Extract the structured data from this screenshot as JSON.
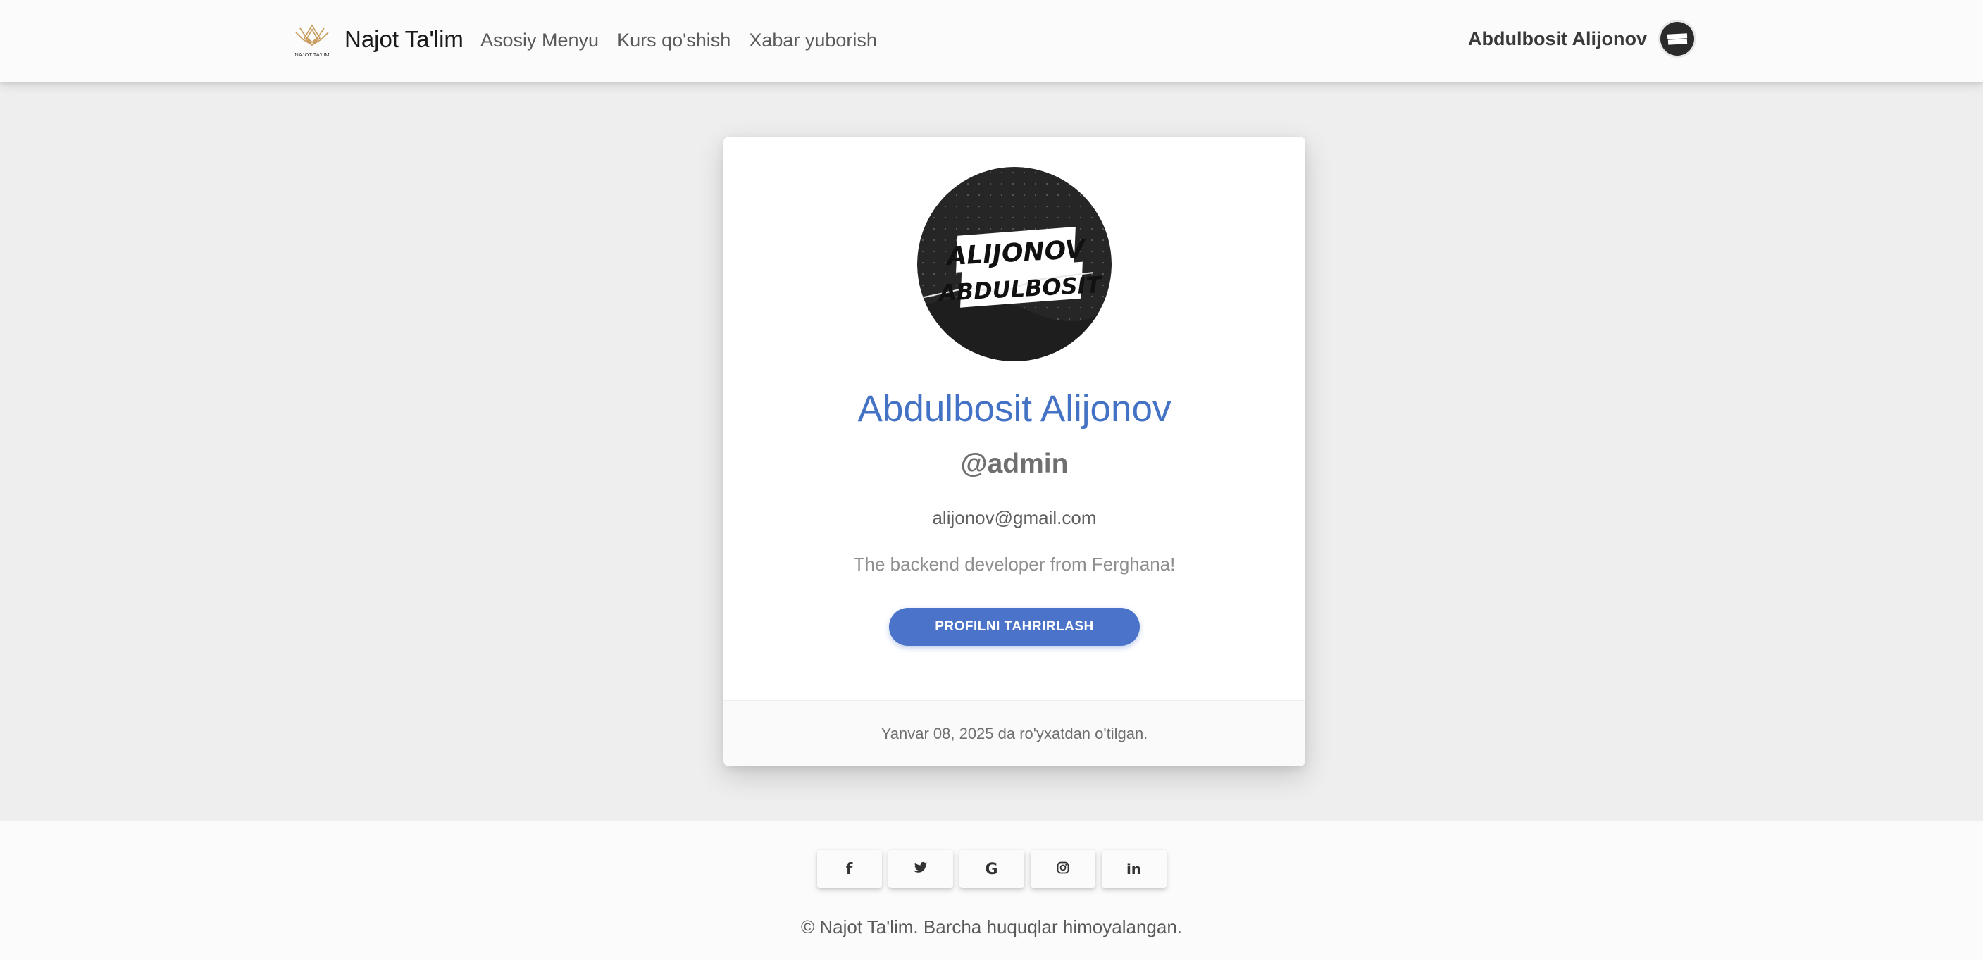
{
  "navbar": {
    "brand_logo_text": "NAJOT TA'LIM",
    "brand_name": "Najot Ta'lim",
    "links": [
      {
        "label": "Asosiy Menyu"
      },
      {
        "label": "Kurs qo'shish"
      },
      {
        "label": "Xabar yuborish"
      }
    ],
    "user_name": "Abdulbosit Alijonov"
  },
  "profile": {
    "avatar_text_line1": "ALIJONOV",
    "avatar_text_line2": "ABDULBOSIT",
    "full_name": "Abdulbosit Alijonov",
    "handle": "@admin",
    "email": "alijonov@gmail.com",
    "bio": "The backend developer from Ferghana!",
    "edit_button_label": "PROFILNI TAHRIRLASH",
    "registered_text": "Yanvar 08, 2025 da ro'yxatdan o'tilgan."
  },
  "footer": {
    "social": [
      {
        "icon": "facebook-icon",
        "glyph": "f"
      },
      {
        "icon": "twitter-icon",
        "glyph": "🐦"
      },
      {
        "icon": "google-icon",
        "glyph": "G"
      },
      {
        "icon": "instagram-icon",
        "glyph": "◎"
      },
      {
        "icon": "linkedin-icon",
        "glyph": "in"
      }
    ],
    "copyright": "© Najot Ta'lim. Barcha huquqlar himoyalangan."
  },
  "colors": {
    "accent": "#4472c4",
    "button": "#4b73c9",
    "background": "#eeeeee",
    "logo_gold": "#c89b5a"
  }
}
